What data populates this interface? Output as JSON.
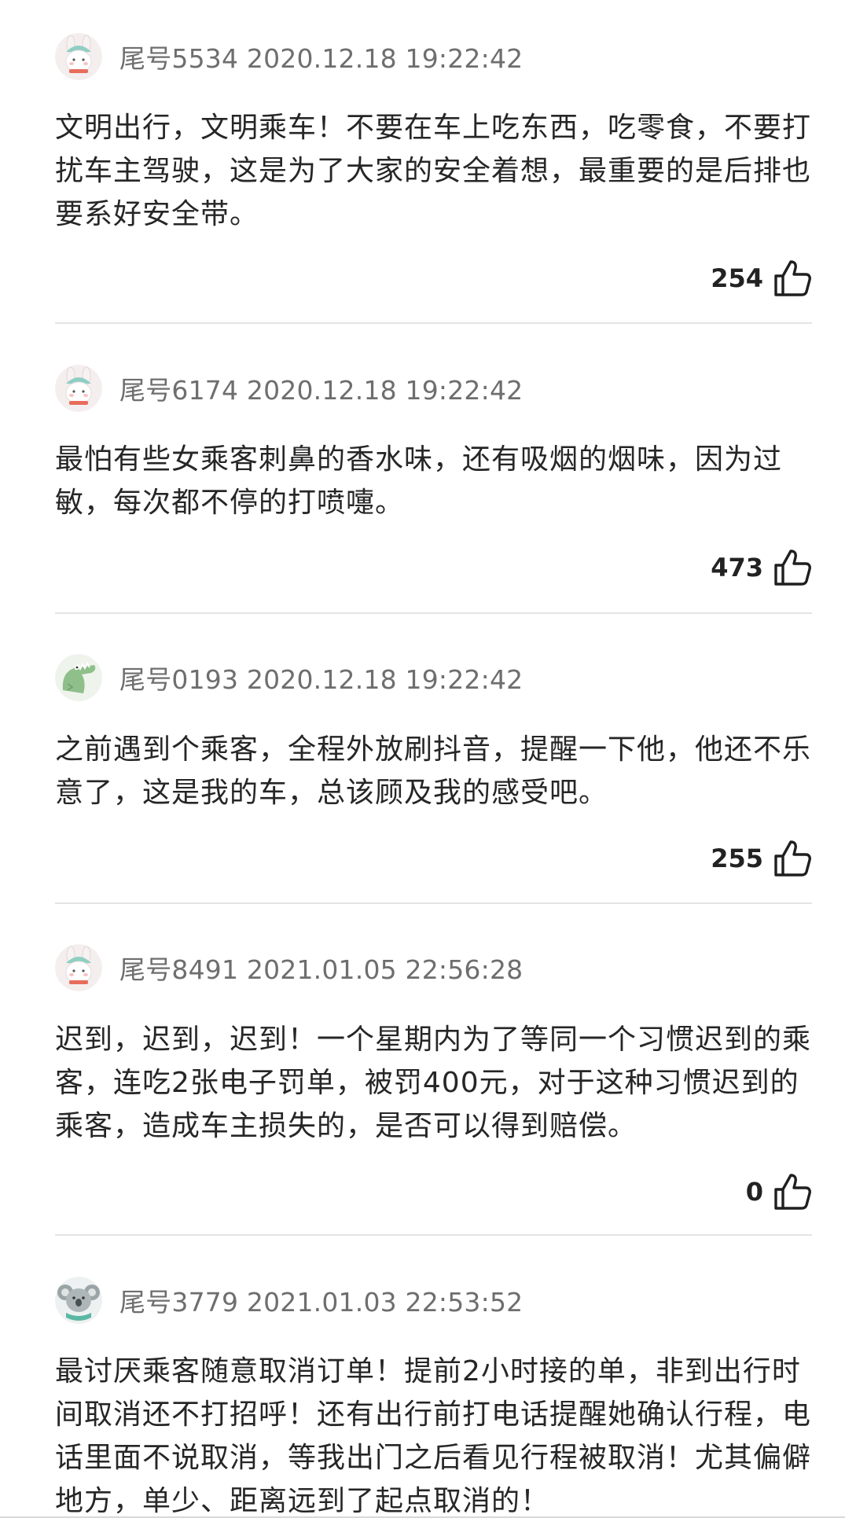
{
  "comments": [
    {
      "user": "尾号5534",
      "time": "2020.12.18 19:22:42",
      "avatar": "bunny-hat-avatar",
      "text": "文明出行，文明乘车！不要在车上吃东西，吃零食，不要打扰车主驾驶，这是为了大家的安全着想，最重要的是后排也要系好安全带。",
      "likes": "254"
    },
    {
      "user": "尾号6174",
      "time": "2020.12.18 19:22:42",
      "avatar": "bunny-hat-avatar",
      "text": "最怕有些女乘客刺鼻的香水味，还有吸烟的烟味，因为过敏，每次都不停的打喷嚏。",
      "likes": "473"
    },
    {
      "user": "尾号0193",
      "time": "2020.12.18 19:22:42",
      "avatar": "crocodile-avatar",
      "text": "之前遇到个乘客，全程外放刷抖音，提醒一下他，他还不乐意了，这是我的车，总该顾及我的感受吧。",
      "likes": "255"
    },
    {
      "user": "尾号8491",
      "time": "2021.01.05 22:56:28",
      "avatar": "bunny-hat-avatar",
      "text": "迟到，迟到，迟到！一个星期内为了等同一个习惯迟到的乘客，连吃2张电子罚单，被罚400元，对于这种习惯迟到的乘客，造成车主损失的，是否可以得到赔偿。",
      "likes": "0"
    },
    {
      "user": "尾号3779",
      "time": "2021.01.03 22:53:52",
      "avatar": "koala-avatar",
      "text": "最讨厌乘客随意取消订单！提前2小时接的单，非到出行时间取消还不打招呼！还有出行前打电话提醒她确认行程，电话里面不说取消，等我出门之后看见行程被取消！尤其偏僻地方，单少、距离远到了起点取消的！",
      "likes": ""
    }
  ],
  "icons": {
    "like": "thumbs-up-icon"
  },
  "colors": {
    "meta_text": "#6e6e6e",
    "body_text": "#262626",
    "divider": "#e4e4e4"
  }
}
